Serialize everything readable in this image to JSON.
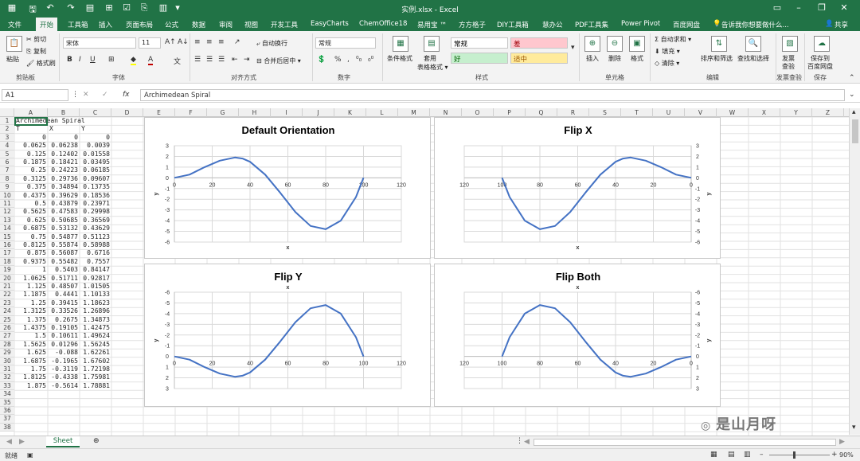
{
  "window": {
    "title": "实例.xlsx - Excel",
    "share": "共享"
  },
  "quick_access": [
    "save-icon",
    "undo-icon",
    "redo-icon",
    "paste-special-icon",
    "border-icon",
    "select-icon",
    "format-painter-icon",
    "table-icon"
  ],
  "tabs": [
    "文件",
    "开始",
    "工具箱",
    "插入",
    "页面布局",
    "公式",
    "数据",
    "审阅",
    "视图",
    "开发工具",
    "EasyCharts",
    "ChemOffice18",
    "易用宝 ™",
    "方方格子",
    "DIY工具箱",
    "慧办公",
    "PDF工具集",
    "Power Pivot",
    "百度网盘"
  ],
  "active_tab": "开始",
  "tell_me": "告诉我你想要做什么...",
  "ribbon": {
    "clipboard": {
      "label": "剪贴板",
      "paste": "粘贴",
      "cut": "剪切",
      "copy": "复制",
      "format_painter": "格式刷"
    },
    "font": {
      "label": "字体",
      "name": "宋体",
      "size": "11",
      "bold": "B",
      "italic": "I",
      "underline": "U",
      "font_color": "#c00000",
      "fill_color": "#ffff00"
    },
    "alignment": {
      "label": "对齐方式",
      "wrap": "自动换行",
      "merge": "合并后居中"
    },
    "number": {
      "label": "数字",
      "format": "常规",
      "percent": "%",
      "comma": ","
    },
    "styles": {
      "label": "样式",
      "conditional": "条件格式",
      "table": "套用\n表格格式",
      "cells": [
        {
          "text": "常规",
          "bg": "#ffffff",
          "fg": "#000000"
        },
        {
          "text": "差",
          "bg": "#ffc7ce",
          "fg": "#9c0006"
        },
        {
          "text": "好",
          "bg": "#c6efce",
          "fg": "#006100"
        },
        {
          "text": "适中",
          "bg": "#ffeb9c",
          "fg": "#9c5700"
        }
      ]
    },
    "cells": {
      "label": "单元格",
      "insert": "插入",
      "delete": "删除",
      "format": "格式"
    },
    "editing": {
      "label": "编辑",
      "autosum": "自动求和",
      "fill": "填充",
      "clear": "清除",
      "sort": "排序和筛选",
      "find": "查找和选择"
    },
    "invoice": {
      "label": "发票查验",
      "btn": "发票\n查验"
    },
    "save": {
      "label": "保存",
      "btn": "保存到\n百度网盘"
    }
  },
  "formula_bar": {
    "namebox": "A1",
    "fx": "fx",
    "content": "Archimedean Spiral"
  },
  "columns": [
    "A",
    "B",
    "C",
    "D",
    "E",
    "F",
    "G",
    "H",
    "I",
    "J",
    "K",
    "L",
    "M",
    "N",
    "O",
    "P",
    "Q",
    "R",
    "S",
    "T",
    "U",
    "V",
    "W",
    "X",
    "Y",
    "Z"
  ],
  "sheet": {
    "title_cell": "Archimedean Spiral",
    "headers": [
      "T",
      "X",
      "Y"
    ],
    "rows": [
      [
        "0",
        "0",
        "0"
      ],
      [
        "0.0625",
        "0.06238",
        "0.0039"
      ],
      [
        "0.125",
        "0.12402",
        "0.01558"
      ],
      [
        "0.1875",
        "0.18421",
        "0.03495"
      ],
      [
        "0.25",
        "0.24223",
        "0.06185"
      ],
      [
        "0.3125",
        "0.29736",
        "0.09607"
      ],
      [
        "0.375",
        "0.34894",
        "0.13735"
      ],
      [
        "0.4375",
        "0.39629",
        "0.18536"
      ],
      [
        "0.5",
        "0.43879",
        "0.23971"
      ],
      [
        "0.5625",
        "0.47583",
        "0.29998"
      ],
      [
        "0.625",
        "0.50685",
        "0.36569"
      ],
      [
        "0.6875",
        "0.53132",
        "0.43629"
      ],
      [
        "0.75",
        "0.54877",
        "0.51123"
      ],
      [
        "0.8125",
        "0.55874",
        "0.58988"
      ],
      [
        "0.875",
        "0.56087",
        "0.6716"
      ],
      [
        "0.9375",
        "0.55482",
        "0.7557"
      ],
      [
        "1",
        "0.5403",
        "0.84147"
      ],
      [
        "1.0625",
        "0.51711",
        "0.92817"
      ],
      [
        "1.125",
        "0.48507",
        "1.01505"
      ],
      [
        "1.1875",
        "0.4441",
        "1.10133"
      ],
      [
        "1.25",
        "0.39415",
        "1.18623"
      ],
      [
        "1.3125",
        "0.33526",
        "1.26896"
      ],
      [
        "1.375",
        "0.2675",
        "1.34873"
      ],
      [
        "1.4375",
        "0.19105",
        "1.42475"
      ],
      [
        "1.5",
        "0.10611",
        "1.49624"
      ],
      [
        "1.5625",
        "0.01296",
        "1.56245"
      ],
      [
        "1.625",
        "-0.088",
        "1.62261"
      ],
      [
        "1.6875",
        "-0.1965",
        "1.67602"
      ],
      [
        "1.75",
        "-0.3119",
        "1.72198"
      ],
      [
        "1.8125",
        "-0.4338",
        "1.75981"
      ],
      [
        "1.875",
        "-0.5614",
        "1.78881"
      ]
    ]
  },
  "sheet_tab": "Sheet",
  "status": {
    "ready": "就绪",
    "zoom": "90%"
  },
  "watermark": "是山月呀",
  "chart_data": [
    {
      "type": "line",
      "title": "Default Orientation",
      "xlabel": "x",
      "ylabel": "y",
      "xlim": [
        0,
        120
      ],
      "ylim": [
        -6,
        3
      ],
      "x_reverse": false,
      "y_reverse": false,
      "xticks": [
        0,
        20,
        40,
        60,
        80,
        100,
        120
      ],
      "yticks": [
        3,
        2,
        1,
        0,
        -1,
        -2,
        -3,
        -4,
        -5,
        -6
      ],
      "series": [
        {
          "x": [
            0,
            8,
            16,
            24,
            32,
            36,
            40,
            48,
            56,
            64,
            72,
            80,
            88,
            96,
            100
          ],
          "y": [
            0,
            0.3,
            1.0,
            1.6,
            1.9,
            1.8,
            1.5,
            0.3,
            -1.4,
            -3.2,
            -4.5,
            -4.8,
            -4.0,
            -1.8,
            0
          ]
        }
      ]
    },
    {
      "type": "line",
      "title": "Flip X",
      "xlabel": "x",
      "ylabel": "y",
      "xlim": [
        0,
        120
      ],
      "ylim": [
        -6,
        3
      ],
      "x_reverse": true,
      "y_reverse": false,
      "xticks": [
        120,
        100,
        80,
        60,
        40,
        20,
        0
      ],
      "yticks": [
        3,
        2,
        1,
        0,
        -1,
        -2,
        -3,
        -4,
        -5,
        -6
      ],
      "series": [
        {
          "x": [
            0,
            8,
            16,
            24,
            32,
            36,
            40,
            48,
            56,
            64,
            72,
            80,
            88,
            96,
            100
          ],
          "y": [
            0,
            0.3,
            1.0,
            1.6,
            1.9,
            1.8,
            1.5,
            0.3,
            -1.4,
            -3.2,
            -4.5,
            -4.8,
            -4.0,
            -1.8,
            0
          ]
        }
      ]
    },
    {
      "type": "line",
      "title": "Flip Y",
      "xlabel": "x",
      "ylabel": "y",
      "xlim": [
        0,
        120
      ],
      "ylim": [
        -6,
        3
      ],
      "x_reverse": false,
      "y_reverse": true,
      "xticks": [
        0,
        20,
        40,
        60,
        80,
        100,
        120
      ],
      "yticks": [
        -6,
        -5,
        -4,
        -3,
        -2,
        -1,
        0,
        1,
        2,
        3
      ],
      "series": [
        {
          "x": [
            0,
            8,
            16,
            24,
            32,
            36,
            40,
            48,
            56,
            64,
            72,
            80,
            88,
            96,
            100
          ],
          "y": [
            0,
            0.3,
            1.0,
            1.6,
            1.9,
            1.8,
            1.5,
            0.3,
            -1.4,
            -3.2,
            -4.5,
            -4.8,
            -4.0,
            -1.8,
            0
          ]
        }
      ]
    },
    {
      "type": "line",
      "title": "Flip Both",
      "xlabel": "x",
      "ylabel": "y",
      "xlim": [
        0,
        120
      ],
      "ylim": [
        -6,
        3
      ],
      "x_reverse": true,
      "y_reverse": true,
      "xticks": [
        120,
        100,
        80,
        60,
        40,
        20,
        0
      ],
      "yticks": [
        -6,
        -5,
        -4,
        -3,
        -2,
        -1,
        0,
        1,
        2,
        3
      ],
      "series": [
        {
          "x": [
            0,
            8,
            16,
            24,
            32,
            36,
            40,
            48,
            56,
            64,
            72,
            80,
            88,
            96,
            100
          ],
          "y": [
            0,
            0.3,
            1.0,
            1.6,
            1.9,
            1.8,
            1.5,
            0.3,
            -1.4,
            -3.2,
            -4.5,
            -4.8,
            -4.0,
            -1.8,
            0
          ]
        }
      ]
    }
  ],
  "line_color": "#4472c4"
}
